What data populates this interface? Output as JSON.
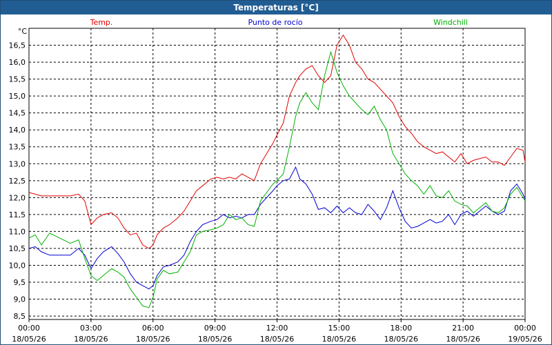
{
  "window": {
    "title": "Temperaturas [°C]"
  },
  "chart_data": {
    "type": "line",
    "title": "Temperaturas [°C]",
    "ylabel": "°C",
    "xlabel": "",
    "ylim": [
      8.4,
      17.0
    ],
    "xlim": [
      0,
      24
    ],
    "grid": true,
    "legend_position": "top",
    "y_ticks": [
      "8,5",
      "9,0",
      "9,5",
      "10,0",
      "10,5",
      "11,0",
      "11,5",
      "12,0",
      "12,5",
      "13,0",
      "13,5",
      "14,0",
      "14,5",
      "15,0",
      "15,5",
      "16,0",
      "16,5"
    ],
    "y_tick_values": [
      8.5,
      9.0,
      9.5,
      10.0,
      10.5,
      11.0,
      11.5,
      12.0,
      12.5,
      13.0,
      13.5,
      14.0,
      14.5,
      15.0,
      15.5,
      16.0,
      16.5
    ],
    "x_ticks": [
      {
        "time": "00:00",
        "date": "18/05/26",
        "value": 0
      },
      {
        "time": "03:00",
        "date": "18/05/26",
        "value": 3
      },
      {
        "time": "06:00",
        "date": "18/05/26",
        "value": 6
      },
      {
        "time": "09:00",
        "date": "18/05/26",
        "value": 9
      },
      {
        "time": "12:00",
        "date": "18/05/26",
        "value": 12
      },
      {
        "time": "15:00",
        "date": "18/05/26",
        "value": 15
      },
      {
        "time": "18:00",
        "date": "18/05/26",
        "value": 18
      },
      {
        "time": "21:00",
        "date": "18/05/26",
        "value": 21
      },
      {
        "time": "00:00",
        "date": "19/05/26",
        "value": 24
      }
    ],
    "series": [
      {
        "name": "Temp.",
        "color": "#e00000",
        "x": [
          0,
          0.3,
          0.6,
          1.0,
          1.5,
          2.0,
          2.4,
          2.7,
          3.0,
          3.3,
          3.6,
          4.0,
          4.3,
          4.6,
          4.9,
          5.2,
          5.5,
          5.8,
          6.0,
          6.2,
          6.5,
          6.8,
          7.2,
          7.5,
          7.8,
          8.1,
          8.4,
          8.8,
          9.1,
          9.4,
          9.7,
          10.0,
          10.3,
          10.6,
          10.9,
          11.2,
          11.5,
          11.8,
          12.0,
          12.3,
          12.6,
          12.9,
          13.1,
          13.4,
          13.7,
          14.0,
          14.3,
          14.6,
          14.9,
          15.2,
          15.5,
          15.8,
          16.1,
          16.4,
          16.7,
          17.0,
          17.3,
          17.6,
          17.9,
          18.2,
          18.5,
          18.8,
          19.1,
          19.4,
          19.7,
          20.0,
          20.3,
          20.6,
          20.9,
          21.2,
          21.5,
          21.8,
          22.1,
          22.4,
          22.7,
          23.0,
          23.3,
          23.6,
          23.9,
          24.0
        ],
        "values": [
          12.15,
          12.1,
          12.05,
          12.05,
          12.05,
          12.05,
          12.1,
          11.9,
          11.2,
          11.4,
          11.5,
          11.55,
          11.4,
          11.1,
          10.9,
          10.95,
          10.6,
          10.5,
          10.6,
          10.9,
          11.1,
          11.2,
          11.4,
          11.6,
          11.9,
          12.2,
          12.35,
          12.55,
          12.6,
          12.55,
          12.6,
          12.55,
          12.7,
          12.6,
          12.5,
          13.0,
          13.3,
          13.6,
          13.85,
          14.2,
          15.0,
          15.4,
          15.6,
          15.8,
          15.9,
          15.6,
          15.4,
          15.6,
          16.5,
          16.8,
          16.5,
          16.0,
          15.8,
          15.5,
          15.4,
          15.2,
          15.0,
          14.8,
          14.4,
          14.1,
          13.9,
          13.65,
          13.5,
          13.4,
          13.3,
          13.35,
          13.2,
          13.05,
          13.3,
          13.0,
          13.1,
          13.15,
          13.2,
          13.05,
          13.05,
          12.95,
          13.2,
          13.45,
          13.4,
          13.05
        ]
      },
      {
        "name": "Punto de rocío",
        "color": "#0000d0",
        "x": [
          0,
          0.3,
          0.6,
          1.0,
          1.5,
          2.0,
          2.4,
          2.7,
          3.0,
          3.3,
          3.6,
          4.0,
          4.3,
          4.6,
          4.9,
          5.2,
          5.5,
          5.8,
          6.0,
          6.2,
          6.5,
          6.8,
          7.2,
          7.5,
          7.8,
          8.1,
          8.4,
          8.8,
          9.1,
          9.4,
          9.7,
          10.0,
          10.3,
          10.6,
          10.9,
          11.2,
          11.5,
          11.8,
          12.0,
          12.3,
          12.6,
          12.9,
          13.1,
          13.4,
          13.7,
          14.0,
          14.3,
          14.6,
          14.9,
          15.2,
          15.5,
          15.8,
          16.1,
          16.4,
          16.7,
          17.0,
          17.3,
          17.6,
          17.9,
          18.2,
          18.5,
          18.8,
          19.1,
          19.4,
          19.7,
          20.0,
          20.3,
          20.6,
          20.9,
          21.2,
          21.5,
          21.8,
          22.1,
          22.4,
          22.7,
          23.0,
          23.3,
          23.6,
          23.9,
          24.0
        ],
        "values": [
          10.5,
          10.55,
          10.4,
          10.3,
          10.3,
          10.3,
          10.5,
          10.3,
          9.9,
          10.2,
          10.4,
          10.55,
          10.35,
          10.1,
          9.75,
          9.5,
          9.4,
          9.3,
          9.4,
          9.7,
          9.95,
          10.0,
          10.1,
          10.3,
          10.7,
          11.0,
          11.2,
          11.3,
          11.35,
          11.5,
          11.4,
          11.45,
          11.4,
          11.5,
          11.5,
          11.8,
          12.0,
          12.2,
          12.35,
          12.5,
          12.55,
          12.9,
          12.55,
          12.4,
          12.1,
          11.65,
          11.7,
          11.55,
          11.75,
          11.55,
          11.7,
          11.55,
          11.5,
          11.8,
          11.6,
          11.35,
          11.7,
          12.2,
          11.7,
          11.3,
          11.1,
          11.15,
          11.25,
          11.35,
          11.25,
          11.3,
          11.5,
          11.2,
          11.5,
          11.6,
          11.45,
          11.6,
          11.75,
          11.6,
          11.5,
          11.6,
          12.2,
          12.4,
          12.1,
          11.95
        ]
      },
      {
        "name": "Windchill",
        "color": "#00b000",
        "x": [
          0,
          0.3,
          0.6,
          1.0,
          1.5,
          2.0,
          2.4,
          2.7,
          3.0,
          3.3,
          3.6,
          4.0,
          4.3,
          4.6,
          4.9,
          5.2,
          5.5,
          5.8,
          6.0,
          6.2,
          6.5,
          6.8,
          7.2,
          7.5,
          7.8,
          8.1,
          8.4,
          8.8,
          9.1,
          9.4,
          9.7,
          10.0,
          10.3,
          10.6,
          10.9,
          11.2,
          11.5,
          11.8,
          12.0,
          12.3,
          12.6,
          12.9,
          13.1,
          13.4,
          13.7,
          14.0,
          14.3,
          14.6,
          14.9,
          15.2,
          15.5,
          15.8,
          16.1,
          16.4,
          16.7,
          17.0,
          17.3,
          17.6,
          17.9,
          18.2,
          18.5,
          18.8,
          19.1,
          19.4,
          19.7,
          20.0,
          20.3,
          20.6,
          20.9,
          21.2,
          21.5,
          21.8,
          22.1,
          22.4,
          22.7,
          23.0,
          23.3,
          23.6,
          23.9,
          24.0
        ],
        "values": [
          10.8,
          10.9,
          10.6,
          10.95,
          10.8,
          10.65,
          10.75,
          10.2,
          9.7,
          9.55,
          9.7,
          9.9,
          9.8,
          9.65,
          9.3,
          9.05,
          8.8,
          8.75,
          9.05,
          9.6,
          9.85,
          9.75,
          9.8,
          10.1,
          10.4,
          10.9,
          11.0,
          11.05,
          11.1,
          11.2,
          11.5,
          11.35,
          11.4,
          11.2,
          11.15,
          11.9,
          12.15,
          12.4,
          12.5,
          12.7,
          13.5,
          14.4,
          14.8,
          15.1,
          14.8,
          14.6,
          15.6,
          16.3,
          15.7,
          15.3,
          15.0,
          14.8,
          14.6,
          14.45,
          14.7,
          14.3,
          14.0,
          13.3,
          13.0,
          12.7,
          12.5,
          12.35,
          12.1,
          12.35,
          12.05,
          12.0,
          12.2,
          11.9,
          11.8,
          11.75,
          11.55,
          11.7,
          11.85,
          11.6,
          11.55,
          11.7,
          12.1,
          12.3,
          12.0,
          11.9
        ]
      }
    ]
  }
}
